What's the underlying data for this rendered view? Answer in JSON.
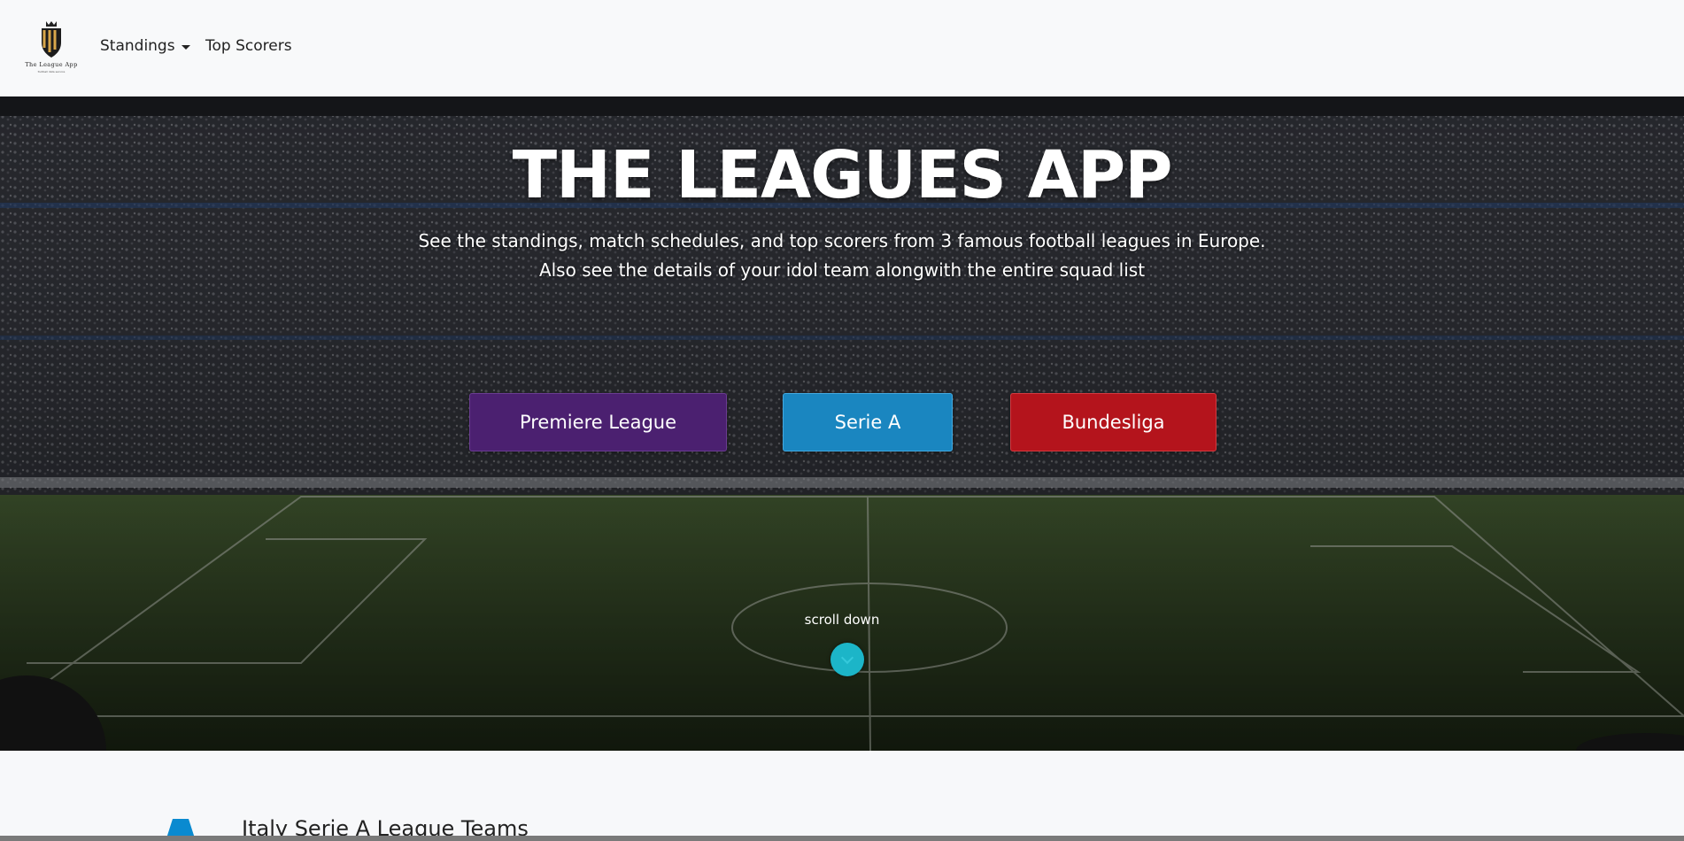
{
  "navbar": {
    "logo_text": "The League App",
    "logo_subtext": "football data service",
    "standings_label": "Standings",
    "top_scorers_label": "Top Scorers"
  },
  "hero": {
    "title": "THE LEAGUES APP",
    "subtitle_line1": "See the standings, match schedules, and top scorers from 3 famous football leagues in Europe.",
    "subtitle_line2": "Also see the details of your idol team alongwith the entire squad list",
    "buttons": {
      "premier_league": "Premiere League",
      "serie_a": "Serie A",
      "bundesliga": "Bundesliga"
    },
    "scroll_label": "scroll down"
  },
  "section": {
    "title": "Italy Serie A League Teams"
  },
  "colors": {
    "premier_league": "#4b2070",
    "serie_a": "#1a86c0",
    "bundesliga": "#b4141c",
    "scroll_button": "#1cb5c8",
    "serie_a_logo": "#0a8ad0"
  }
}
